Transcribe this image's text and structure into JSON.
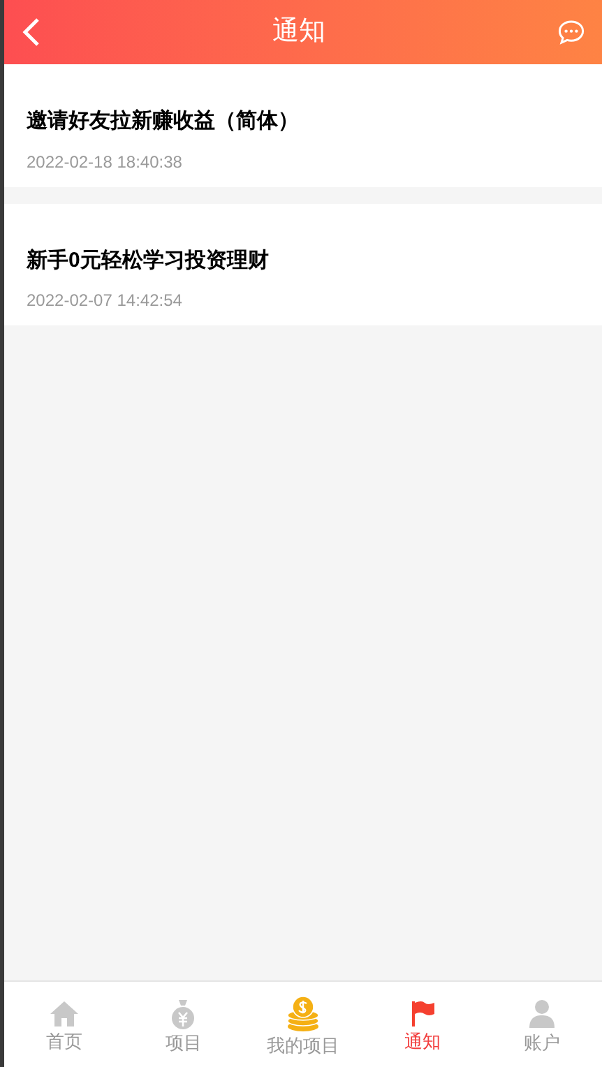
{
  "header": {
    "title": "通知"
  },
  "notices": [
    {
      "title": "邀请好友拉新赚收益（简体）",
      "time": "2022-02-18 18:40:38"
    },
    {
      "title": "新手0元轻松学习投资理财",
      "time": "2022-02-07 14:42:54"
    }
  ],
  "tab_bar": [
    {
      "kind": "home",
      "label": "首页",
      "selected": false
    },
    {
      "kind": "bag",
      "label": "项目",
      "selected": false
    },
    {
      "kind": "coins",
      "label": "我的项目",
      "selected": false
    },
    {
      "kind": "flag",
      "label": "通知",
      "selected": true
    },
    {
      "kind": "person",
      "label": "账户",
      "selected": false
    }
  ]
}
